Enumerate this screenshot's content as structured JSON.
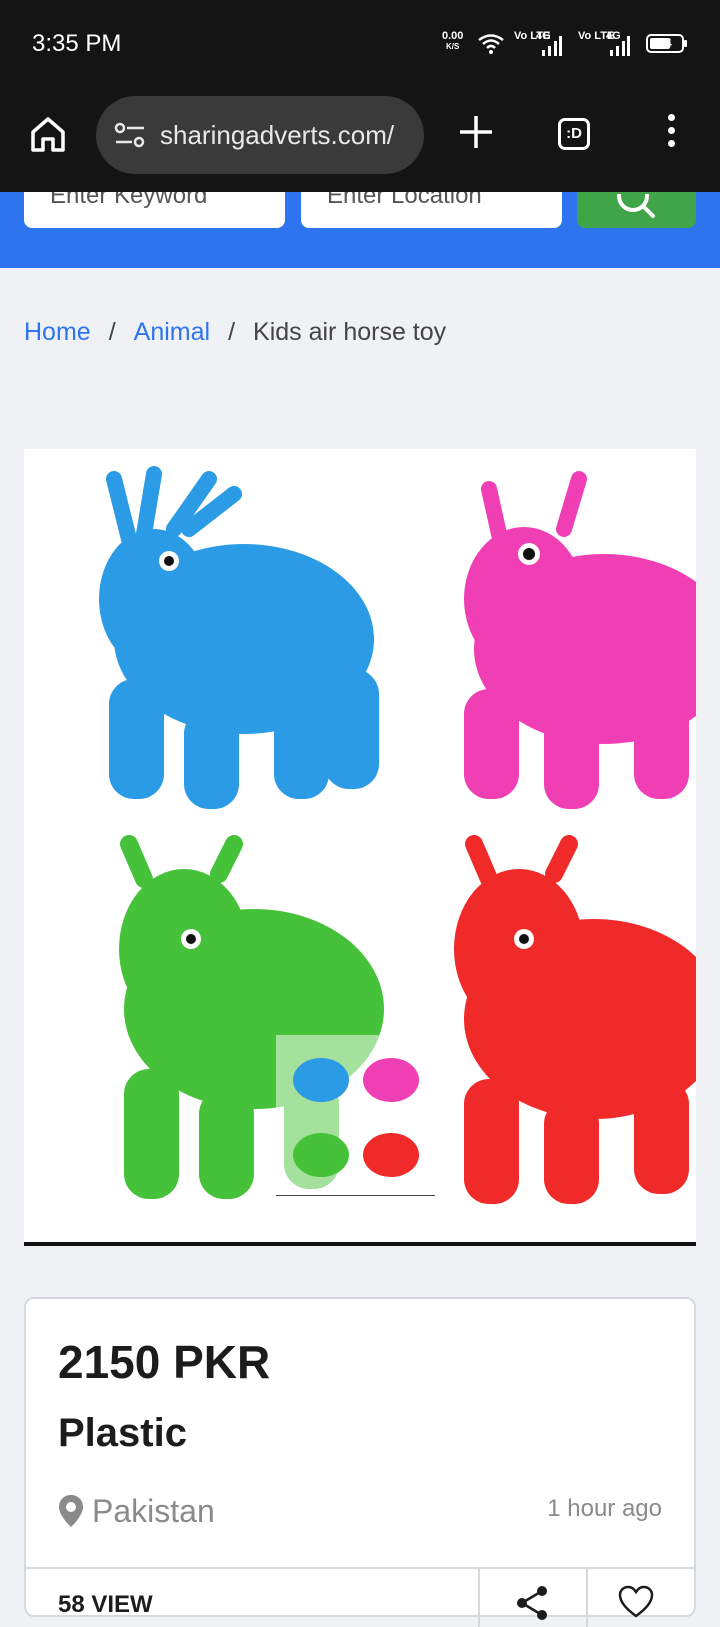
{
  "status_bar": {
    "time": "3:35 PM",
    "net_speed": "0.00",
    "net_unit": "K/S",
    "volte1": "Vo LTE",
    "net1": "4G",
    "volte2": "Vo LTE",
    "net2": "4G",
    "battery": "54"
  },
  "browser": {
    "url": "sharingadverts.com/",
    "tabs_label": ":D"
  },
  "search": {
    "keyword_placeholder": "Enter Keyword",
    "location_placeholder": "Enter Location"
  },
  "breadcrumb": {
    "home": "Home",
    "category": "Animal",
    "current": "Kids air horse toy"
  },
  "listing": {
    "image_subject": "Inflatable ride-on animal toys: blue deer, pink cow, green horse, red horse",
    "toy_colors": [
      "#2a9be4",
      "#f03fb5",
      "#46c23a",
      "#ef2a28"
    ],
    "price": "2150 PKR",
    "title": "Plastic",
    "location": "Pakistan",
    "posted": "1 hour ago",
    "views": "58 VIEW"
  }
}
